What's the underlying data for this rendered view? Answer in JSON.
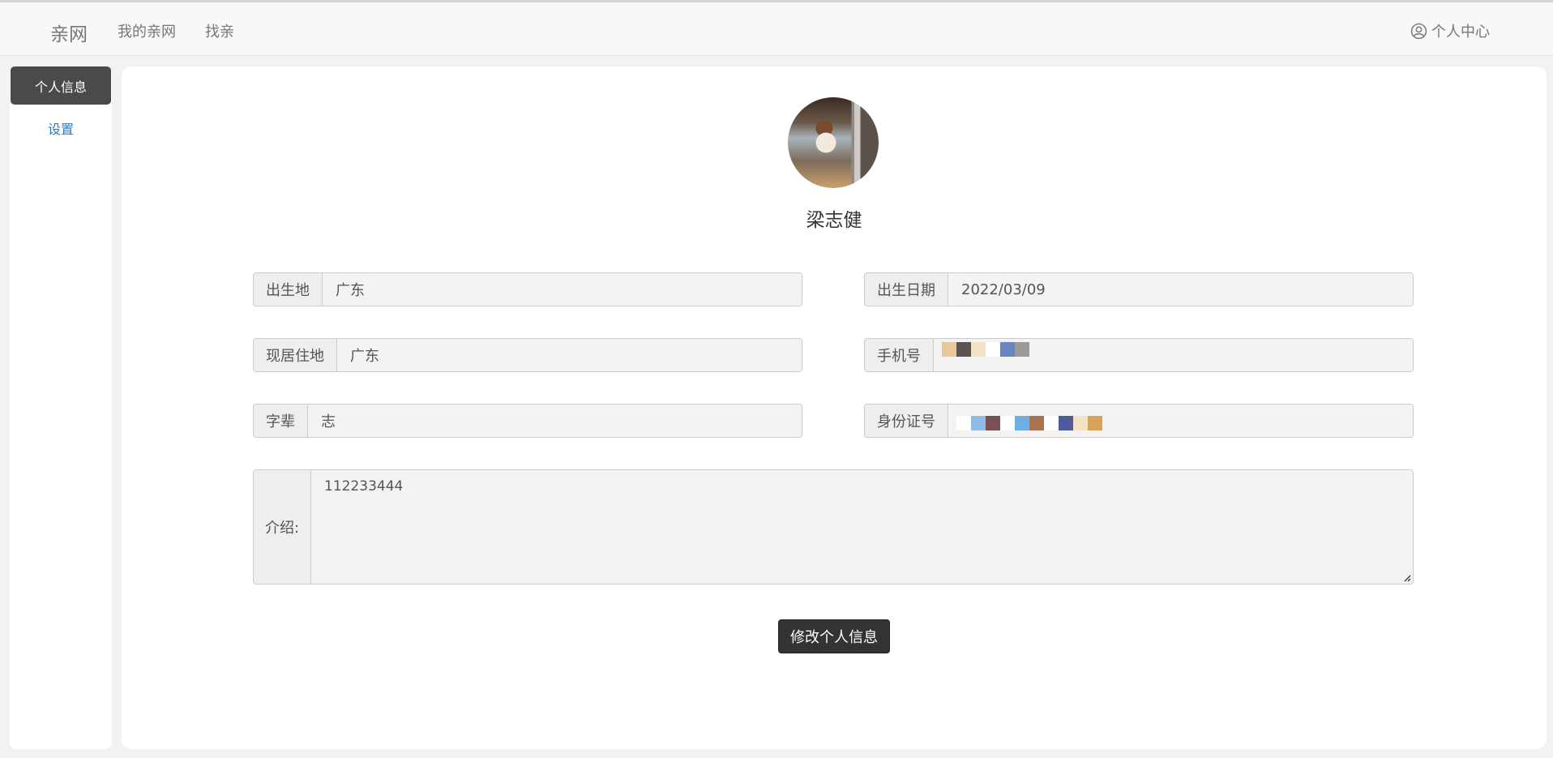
{
  "nav": {
    "brand": "亲网",
    "links": [
      "我的亲网",
      "找亲"
    ],
    "user_center": "个人中心"
  },
  "sidebar": {
    "items": [
      {
        "label": "个人信息",
        "active": true
      },
      {
        "label": "设置",
        "active": false
      }
    ]
  },
  "profile": {
    "name": "梁志健",
    "fields": {
      "birthplace": {
        "label": "出生地",
        "value": "广东"
      },
      "birthdate": {
        "label": "出生日期",
        "value": "2022/03/09"
      },
      "residence": {
        "label": "现居住地",
        "value": "广东"
      },
      "phone": {
        "label": "手机号",
        "value": ""
      },
      "generation": {
        "label": "字辈",
        "value": "志"
      },
      "id_number": {
        "label": "身份证号",
        "value": ""
      }
    },
    "intro": {
      "label": "介绍:",
      "value": "112233444"
    },
    "submit_label": "修改个人信息"
  },
  "colors": {
    "sidebar_active_bg": "#4a4a4a",
    "link": "#337ab7",
    "button_bg": "#333333",
    "mosaic_phone": [
      "#e8c89a",
      "#5a5452",
      "#f3e2c4",
      "#ffffff",
      "#6b86bf",
      "#9a9a9a"
    ],
    "mosaic_id": [
      "#ffffff",
      "#8fbbe6",
      "#7a5055",
      "#ffffff",
      "#6faee0",
      "#a8744f",
      "#ffffff",
      "#4f5a9a",
      "#f3e2c4",
      "#d9a35a"
    ]
  }
}
